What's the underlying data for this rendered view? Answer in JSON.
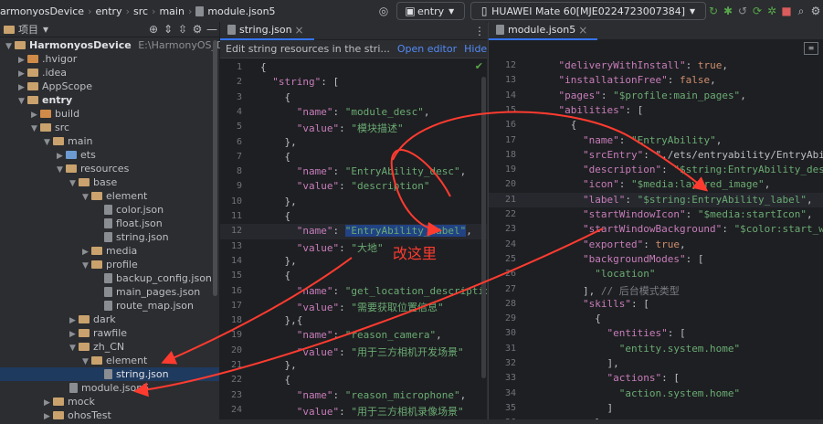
{
  "topbar": {
    "crumbs": [
      "armonyosDevice",
      "entry",
      "src",
      "main",
      "module.json5"
    ],
    "run_config": "entry",
    "device": "HUAWEI Mate 60[MJE0224723007384]"
  },
  "project_panel": {
    "title": "项目",
    "root": {
      "name": "HarmonyosDevice",
      "path": "E:\\HarmonyOS_Demo\\Harm"
    },
    "items": [
      {
        "label": ".hvigor"
      },
      {
        "label": ".idea"
      },
      {
        "label": "AppScope"
      },
      {
        "label": "entry"
      },
      {
        "label": "build"
      },
      {
        "label": "src"
      },
      {
        "label": "main"
      },
      {
        "label": "ets"
      },
      {
        "label": "resources"
      },
      {
        "label": "base"
      },
      {
        "label": "element"
      },
      {
        "label": "color.json"
      },
      {
        "label": "float.json"
      },
      {
        "label": "string.json"
      },
      {
        "label": "media"
      },
      {
        "label": "profile"
      },
      {
        "label": "backup_config.json"
      },
      {
        "label": "main_pages.json"
      },
      {
        "label": "route_map.json"
      },
      {
        "label": "dark"
      },
      {
        "label": "rawfile"
      },
      {
        "label": "zh_CN"
      },
      {
        "label": "element"
      },
      {
        "label": "string.json"
      },
      {
        "label": "module.json5"
      },
      {
        "label": "mock"
      },
      {
        "label": "ohosTest"
      }
    ]
  },
  "left_editor": {
    "tab": "string.json",
    "notification": "Edit string resources in the stri...",
    "open_editor": "Open editor",
    "hide_notification": "Hide notification",
    "lines": [
      {
        "n": "1",
        "t": "{"
      },
      {
        "n": "2",
        "t": "  \"string\": ["
      },
      {
        "n": "3",
        "t": "    {"
      },
      {
        "n": "4",
        "t": "      \"name\": \"module_desc\","
      },
      {
        "n": "5",
        "t": "      \"value\": \"模块描述\""
      },
      {
        "n": "6",
        "t": "    },"
      },
      {
        "n": "7",
        "t": "    {"
      },
      {
        "n": "8",
        "t": "      \"name\": \"EntryAbility_desc\","
      },
      {
        "n": "9",
        "t": "      \"value\": \"description\""
      },
      {
        "n": "10",
        "t": "    },"
      },
      {
        "n": "11",
        "t": "    {"
      },
      {
        "n": "12",
        "t": "      \"name\": \"EntryAbility_label\","
      },
      {
        "n": "13",
        "t": "      \"value\": \"大地\""
      },
      {
        "n": "14",
        "t": "    },"
      },
      {
        "n": "15",
        "t": "    {"
      },
      {
        "n": "16",
        "t": "      \"name\": \"get_location_description\","
      },
      {
        "n": "17",
        "t": "      \"value\": \"需要获取位置信息\""
      },
      {
        "n": "18",
        "t": "    },{"
      },
      {
        "n": "19",
        "t": "      \"name\": \"reason_camera\","
      },
      {
        "n": "20",
        "t": "      \"value\": \"用于三方相机开发场景\""
      },
      {
        "n": "21",
        "t": "    },"
      },
      {
        "n": "22",
        "t": "    {"
      },
      {
        "n": "23",
        "t": "      \"name\": \"reason_microphone\","
      },
      {
        "n": "24",
        "t": "      \"value\": \"用于三方相机录像场景\""
      }
    ]
  },
  "right_editor": {
    "tab": "module.json5",
    "lines": [
      {
        "n": "12",
        "t": "    \"deliveryWithInstall\": true,"
      },
      {
        "n": "13",
        "t": "    \"installationFree\": false,"
      },
      {
        "n": "14",
        "t": "    \"pages\": \"$profile:main_pages\","
      },
      {
        "n": "15",
        "t": "    \"abilities\": ["
      },
      {
        "n": "16",
        "t": "      {"
      },
      {
        "n": "17",
        "t": "        \"name\": \"EntryAbility\","
      },
      {
        "n": "18",
        "t": "        \"srcEntry\": \"./ets/entryability/EntryAbility."
      },
      {
        "n": "19",
        "t": "        \"description\": \"$string:EntryAbility_desc\","
      },
      {
        "n": "20",
        "t": "        \"icon\": \"$media:layered_image\","
      },
      {
        "n": "21",
        "t": "        \"label\": \"$string:EntryAbility_label\","
      },
      {
        "n": "22",
        "t": "        \"startWindowIcon\": \"$media:startIcon\","
      },
      {
        "n": "23",
        "t": "        \"startWindowBackground\": \"$color:start_window_background\","
      },
      {
        "n": "24",
        "t": "        \"exported\": true,"
      },
      {
        "n": "25",
        "t": "        \"backgroundModes\": ["
      },
      {
        "n": "26",
        "t": "          \"location\""
      },
      {
        "n": "27",
        "t": "        ], // 后台模式类型"
      },
      {
        "n": "28",
        "t": "        \"skills\": ["
      },
      {
        "n": "29",
        "t": "          {"
      },
      {
        "n": "30",
        "t": "            \"entities\": ["
      },
      {
        "n": "31",
        "t": "              \"entity.system.home\""
      },
      {
        "n": "32",
        "t": "            ],"
      },
      {
        "n": "33",
        "t": "            \"actions\": ["
      },
      {
        "n": "34",
        "t": "              \"action.system.home\""
      },
      {
        "n": "35",
        "t": "            ]"
      },
      {
        "n": "36",
        "t": "          }"
      }
    ]
  },
  "annotation": {
    "text": "改这里",
    "color": "#ff3b30"
  }
}
